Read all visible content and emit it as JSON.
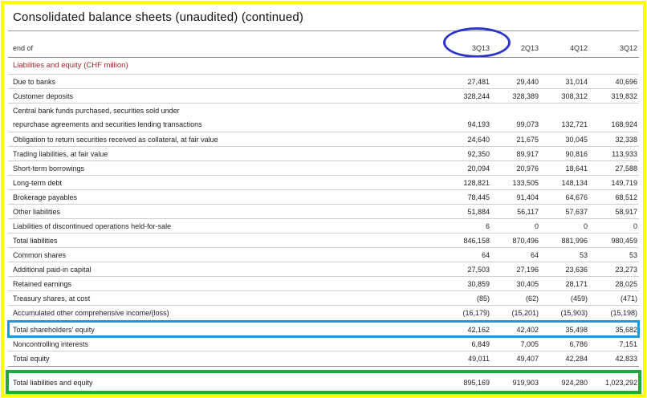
{
  "title": "Consolidated balance sheets (unaudited) (continued)",
  "header": {
    "label": "end of",
    "columns": [
      "3Q13",
      "2Q13",
      "4Q12",
      "3Q12"
    ]
  },
  "section_title": "Liabilities and equity (CHF million)",
  "rows": [
    {
      "label": "Due to banks",
      "values": [
        "27,481",
        "29,440",
        "31,014",
        "40,696"
      ]
    },
    {
      "label": "Customer deposits",
      "values": [
        "328,244",
        "328,389",
        "308,312",
        "319,832"
      ]
    },
    {
      "label": "Central bank funds purchased, securities sold under",
      "label2": "repurchase agreements and securities lending transactions",
      "values": [
        "94,193",
        "99,073",
        "132,721",
        "168,924"
      ]
    },
    {
      "label": "Obligation to return securities received as collateral, at fair value",
      "values": [
        "24,640",
        "21,675",
        "30,045",
        "32,338"
      ]
    },
    {
      "label": "Trading liabilities, at fair value",
      "values": [
        "92,350",
        "89,917",
        "90,816",
        "113,933"
      ]
    },
    {
      "label": "Short-term borrowings",
      "values": [
        "20,094",
        "20,976",
        "18,641",
        "27,588"
      ]
    },
    {
      "label": "Long-term debt",
      "values": [
        "128,821",
        "133,505",
        "148,134",
        "149,719"
      ]
    },
    {
      "label": "Brokerage payables",
      "values": [
        "78,445",
        "91,404",
        "64,676",
        "68,512"
      ]
    },
    {
      "label": "Other liabilities",
      "values": [
        "51,884",
        "56,117",
        "57,637",
        "58,917"
      ]
    },
    {
      "label": "Liabilities of discontinued operations held-for-sale",
      "values": [
        "6",
        "0",
        "0",
        "0"
      ]
    },
    {
      "label": "Total liabilities",
      "values": [
        "846,158",
        "870,496",
        "881,996",
        "980,459"
      ]
    },
    {
      "label": "Common shares",
      "values": [
        "64",
        "64",
        "53",
        "53"
      ]
    },
    {
      "label": "Additional paid-in capital",
      "values": [
        "27,503",
        "27,196",
        "23,636",
        "23,273"
      ]
    },
    {
      "label": "Retained earnings",
      "values": [
        "30,859",
        "30,405",
        "28,171",
        "28,025"
      ]
    },
    {
      "label": "Treasury shares, at cost",
      "values": [
        "(85)",
        "(62)",
        "(459)",
        "(471)"
      ]
    },
    {
      "label": "Accumulated other comprehensive income/(loss)",
      "values": [
        "(16,179)",
        "(15,201)",
        "(15,903)",
        "(15,198)"
      ]
    },
    {
      "label": "Total shareholders' equity",
      "values": [
        "42,162",
        "42,402",
        "35,498",
        "35,682"
      ]
    },
    {
      "label": "Noncontrolling interests",
      "values": [
        "6,849",
        "7,005",
        "6,786",
        "7,151"
      ]
    },
    {
      "label": "Total equity",
      "values": [
        "49,011",
        "49,407",
        "42,284",
        "42,833"
      ]
    },
    {
      "label": "Total liabilities and equity",
      "values": [
        "895,169",
        "919,903",
        "924,280",
        "1,023,292"
      ]
    }
  ]
}
